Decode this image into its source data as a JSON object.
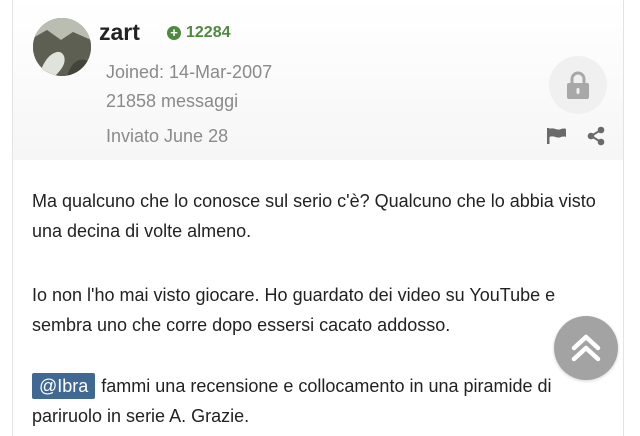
{
  "colors": {
    "reputation": "#4e8a3d",
    "mention_bg": "#3f6892",
    "meta_text": "#8a8a8a",
    "body_text": "#222222"
  },
  "author": {
    "name": "zart",
    "reputation": "12284",
    "joined": "Joined: 14-Mar-2007",
    "messages": "21858 messaggi",
    "posted": "Inviato June 28"
  },
  "icons": {
    "reputation": "plus-circle-icon",
    "lock": "lock-icon",
    "report": "flag-icon",
    "share": "share-icon",
    "scroll_top": "chevron-double-up-icon"
  },
  "post": {
    "paragraph1": "Ma qualcuno che lo conosce sul serio c'è? Qualcuno che lo abbia visto una decina di volte almeno.",
    "paragraph2": "Io non l'ho mai visto giocare. Ho guardato dei video su YouTube e sembra uno che corre dopo essersi cacato addosso.",
    "mention": "@Ibra",
    "paragraph3": "fammi una recensione e collocamento in una piramide di pariruolo in serie A. Grazie."
  }
}
